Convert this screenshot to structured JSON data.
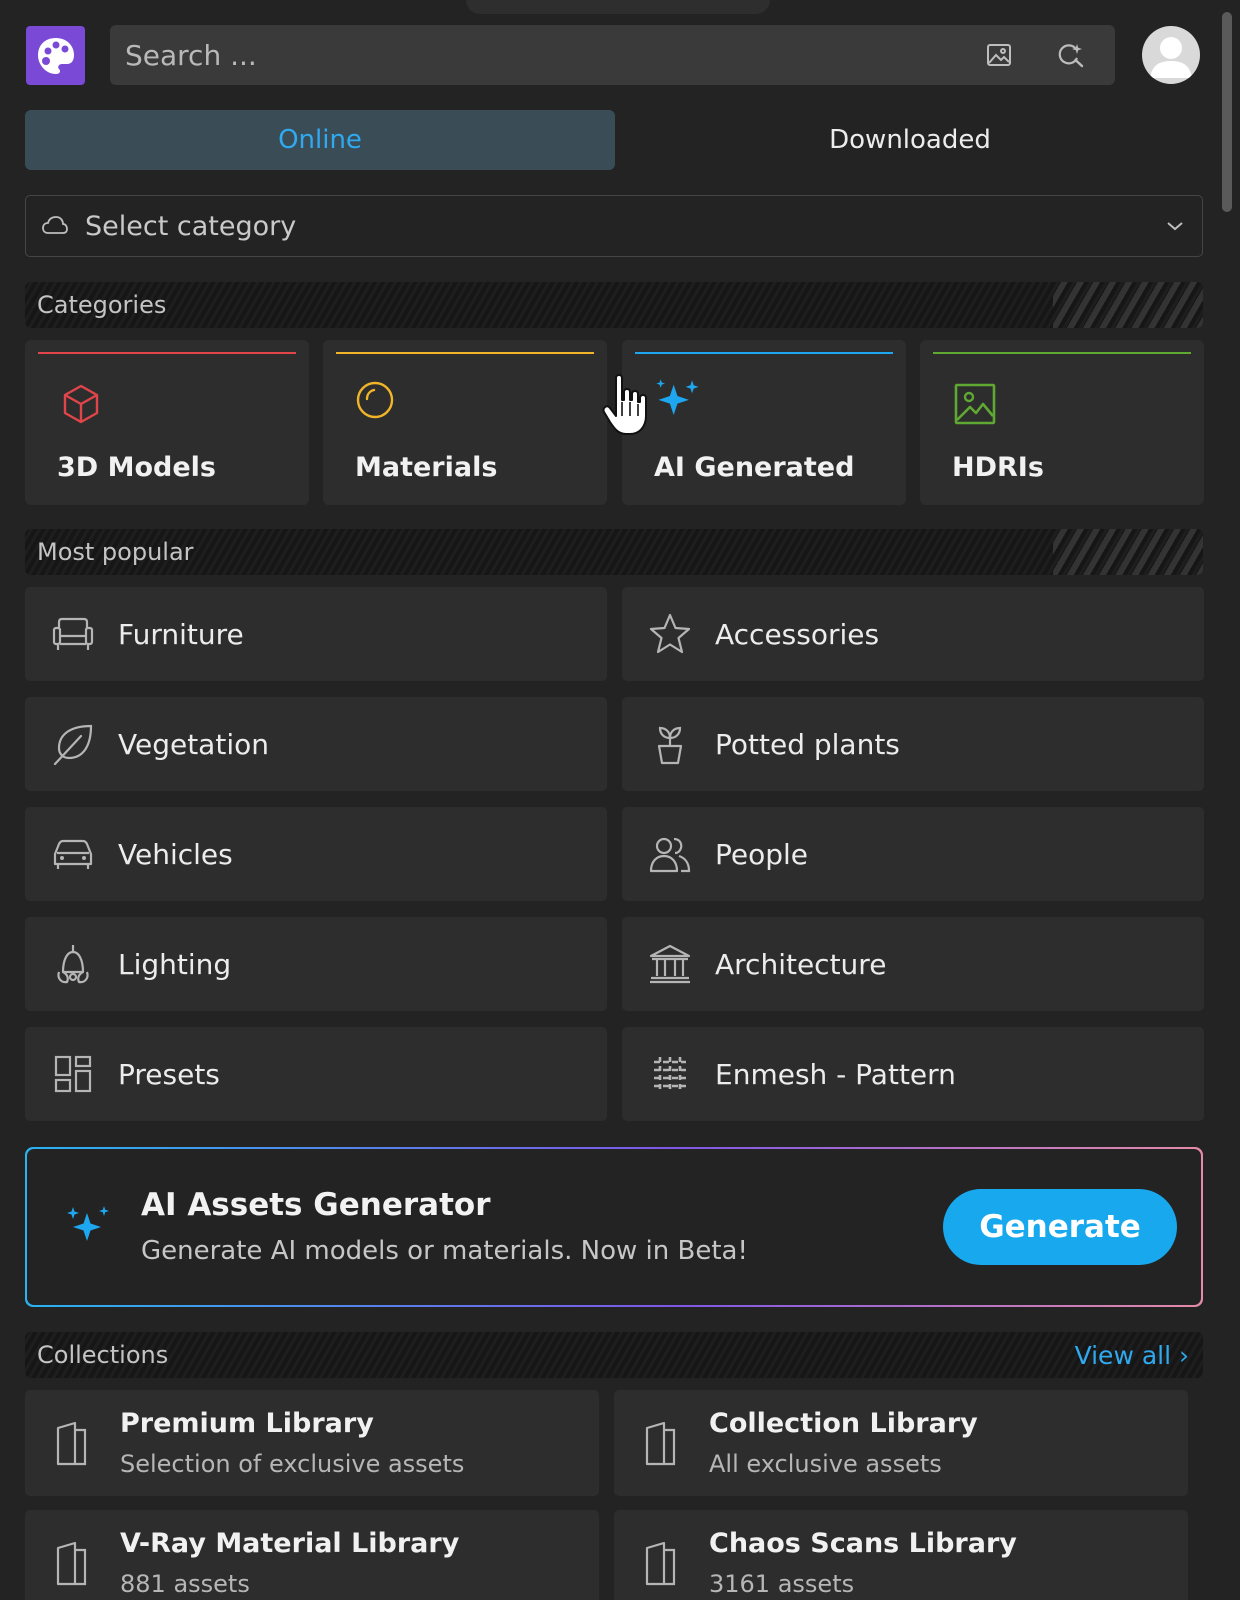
{
  "search": {
    "placeholder": "Search ..."
  },
  "tabs": [
    {
      "label": "Online",
      "active": true
    },
    {
      "label": "Downloaded",
      "active": false
    }
  ],
  "category_select": {
    "value": "Select category"
  },
  "sections": {
    "categories": "Categories",
    "most_popular": "Most popular",
    "collections": "Collections",
    "view_all": "View all ›"
  },
  "categories": [
    {
      "label": "3D Models",
      "icon": "cube-icon",
      "accent": "#e0454a"
    },
    {
      "label": "Materials",
      "icon": "sphere-icon",
      "accent": "#f0b429"
    },
    {
      "label": "AI Generated",
      "icon": "sparkles-icon",
      "accent": "#1ea7f0"
    },
    {
      "label": "HDRIs",
      "icon": "image-icon",
      "accent": "#5fa832"
    }
  ],
  "popular": [
    {
      "label": "Furniture",
      "icon": "sofa-icon"
    },
    {
      "label": "Accessories",
      "icon": "star-icon"
    },
    {
      "label": "Vegetation",
      "icon": "leaf-icon"
    },
    {
      "label": "Potted plants",
      "icon": "potted-plant-icon"
    },
    {
      "label": "Vehicles",
      "icon": "car-icon"
    },
    {
      "label": "People",
      "icon": "people-icon"
    },
    {
      "label": "Lighting",
      "icon": "lamp-icon"
    },
    {
      "label": "Architecture",
      "icon": "building-icon"
    },
    {
      "label": "Presets",
      "icon": "layout-icon"
    },
    {
      "label": "Enmesh - Pattern",
      "icon": "pattern-icon"
    }
  ],
  "ai_banner": {
    "title": "AI Assets Generator",
    "subtitle": "Generate AI models or materials. Now in Beta!",
    "button": "Generate"
  },
  "collections": [
    {
      "title": "Premium Library",
      "subtitle": "Selection of exclusive assets"
    },
    {
      "title": "Collection Library",
      "subtitle": "All exclusive assets"
    },
    {
      "title": "V-Ray Material Library",
      "subtitle": "881 assets"
    },
    {
      "title": "Chaos Scans Library",
      "subtitle": "3161 assets"
    }
  ],
  "colors": {
    "accent": "#17a8ee",
    "logo": "#7a4ad6",
    "background": "#232323",
    "card": "#2d2d2d"
  }
}
